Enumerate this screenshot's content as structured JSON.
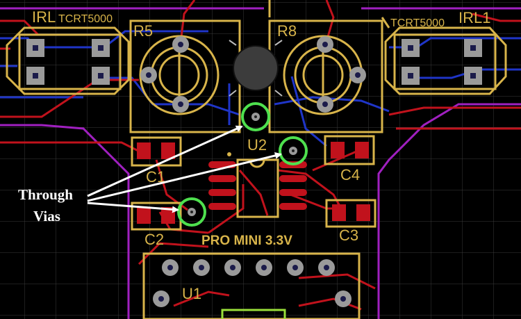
{
  "labels": {
    "irl_left": "IRL",
    "tcrt_left": "TCRT5000",
    "tcrt_right": "TCRT5000",
    "irl_right": "IRL1",
    "r5": "R5",
    "r8": "R8",
    "u2": "U2",
    "c1": "C1",
    "c2": "C2",
    "c3": "C3",
    "c4": "C4",
    "board": "PRO MINI 3.3V",
    "u1": "U1"
  },
  "annotation": {
    "line1": "Through",
    "line2": "Vias"
  },
  "colors": {
    "background": "#000000",
    "grid": "#3a3a3a",
    "silkscreen": "#d8b44a",
    "copper_top": "#c1121c",
    "copper_bottom": "#1f35c8",
    "board_outline": "#a020c0",
    "pad": "#9a9a9a",
    "via_highlight": "#4ee04e",
    "annotation": "#ffffff"
  }
}
